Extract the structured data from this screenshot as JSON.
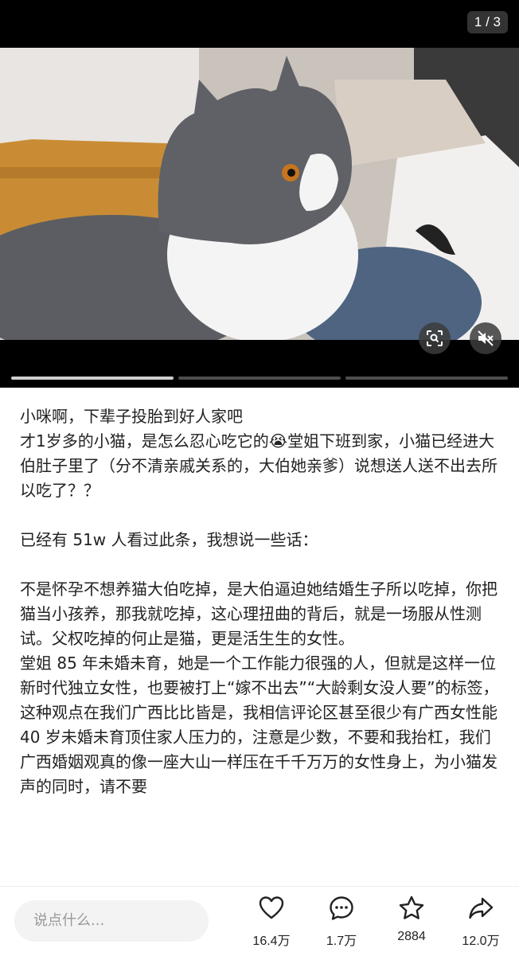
{
  "media": {
    "counter": "1 / 3",
    "image_description_icon": "cat-photo",
    "scan_icon": "scan-icon",
    "mute_icon": "mute-icon",
    "pages": 3,
    "active_page": 1
  },
  "post": {
    "title": "小咪啊，下辈子投胎到好人家吧",
    "p1": "才1岁多的小猫，是怎么忍心吃它的😭堂姐下班到家，小猫已经进大伯肚子里了（分不清亲戚关系的，大伯她亲爹）说想送人送不出去所以吃了？？",
    "p2": "已经有 51w 人看过此条，我想说一些话：",
    "p3": "不是怀孕不想养猫大伯吃掉，是大伯逼迫她结婚生子所以吃掉，你把猫当小孩养，那我就吃掉，这心理扭曲的背后，就是一场服从性测试。父权吃掉的何止是猫，更是活生生的女性。",
    "p4": "堂姐 85 年未婚未育，她是一个工作能力很强的人，但就是这样一位新时代独立女性，也要被打上“嫁不出去”“大龄剩女没人要”的标签，这种观点在我们广西比比皆是，我相信评论区甚至很少有广西女性能 40 岁未婚未育顶住家人压力的，注意是少数，不要和我抬杠，我们广西婚姻观真的像一座大山一样压在千千万万的女性身上，为小猫发声的同时，请不要"
  },
  "bottom_bar": {
    "comment_placeholder": "说点什么...",
    "like_count": "16.4万",
    "comment_count": "1.7万",
    "favorite_count": "2884",
    "share_count": "12.0万"
  }
}
